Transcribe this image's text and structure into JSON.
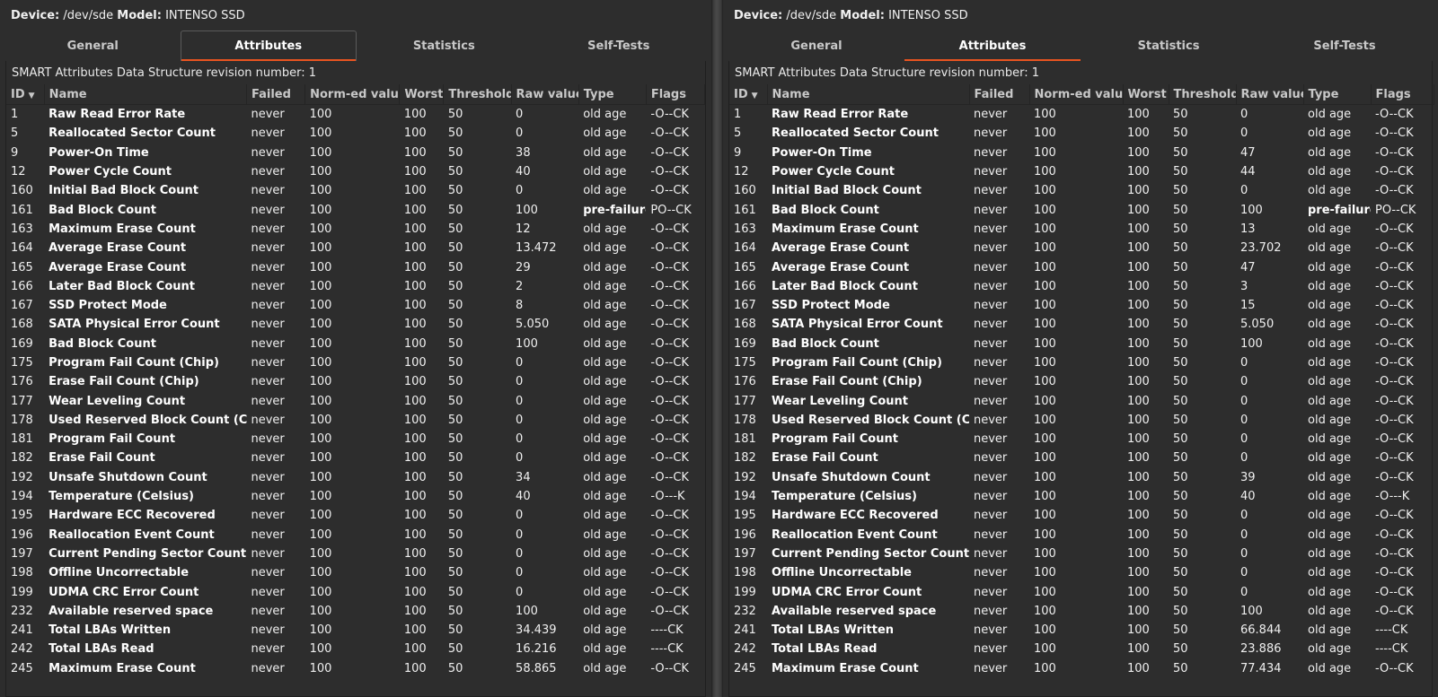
{
  "panels": [
    {
      "device_label": "Device:",
      "device_value": "/dev/sde",
      "model_label": "Model:",
      "model_value": "INTENSO SSD",
      "tabs": [
        "General",
        "Attributes",
        "Statistics",
        "Self-Tests"
      ],
      "active_tab": 1,
      "revision_text": "SMART Attributes Data Structure revision number: 1",
      "columns": [
        "ID",
        "Name",
        "Failed",
        "Norm-ed value",
        "Worst",
        "Threshold",
        "Raw value",
        "Type",
        "Flags"
      ],
      "sort_icon": "sort-descending-icon",
      "rows": [
        [
          "1",
          "Raw Read Error Rate",
          "never",
          "100",
          "100",
          "50",
          "0",
          "old age",
          "-O--CK"
        ],
        [
          "5",
          "Reallocated Sector Count",
          "never",
          "100",
          "100",
          "50",
          "0",
          "old age",
          "-O--CK"
        ],
        [
          "9",
          "Power-On Time",
          "never",
          "100",
          "100",
          "50",
          "38",
          "old age",
          "-O--CK"
        ],
        [
          "12",
          "Power Cycle Count",
          "never",
          "100",
          "100",
          "50",
          "40",
          "old age",
          "-O--CK"
        ],
        [
          "160",
          "Initial Bad Block Count",
          "never",
          "100",
          "100",
          "50",
          "0",
          "old age",
          "-O--CK"
        ],
        [
          "161",
          "Bad Block Count",
          "never",
          "100",
          "100",
          "50",
          "100",
          "pre-failure",
          "PO--CK"
        ],
        [
          "163",
          "Maximum Erase Count",
          "never",
          "100",
          "100",
          "50",
          "12",
          "old age",
          "-O--CK"
        ],
        [
          "164",
          "Average Erase Count",
          "never",
          "100",
          "100",
          "50",
          "13.472",
          "old age",
          "-O--CK"
        ],
        [
          "165",
          "Average Erase Count",
          "never",
          "100",
          "100",
          "50",
          "29",
          "old age",
          "-O--CK"
        ],
        [
          "166",
          "Later Bad Block Count",
          "never",
          "100",
          "100",
          "50",
          "2",
          "old age",
          "-O--CK"
        ],
        [
          "167",
          "SSD Protect Mode",
          "never",
          "100",
          "100",
          "50",
          "8",
          "old age",
          "-O--CK"
        ],
        [
          "168",
          "SATA Physical Error Count",
          "never",
          "100",
          "100",
          "50",
          "5.050",
          "old age",
          "-O--CK"
        ],
        [
          "169",
          "Bad Block Count",
          "never",
          "100",
          "100",
          "50",
          "100",
          "old age",
          "-O--CK"
        ],
        [
          "175",
          "Program Fail Count (Chip)",
          "never",
          "100",
          "100",
          "50",
          "0",
          "old age",
          "-O--CK"
        ],
        [
          "176",
          "Erase Fail Count (Chip)",
          "never",
          "100",
          "100",
          "50",
          "0",
          "old age",
          "-O--CK"
        ],
        [
          "177",
          "Wear Leveling Count",
          "never",
          "100",
          "100",
          "50",
          "0",
          "old age",
          "-O--CK"
        ],
        [
          "178",
          "Used Reserved Block Count (Chip)",
          "never",
          "100",
          "100",
          "50",
          "0",
          "old age",
          "-O--CK"
        ],
        [
          "181",
          "Program Fail Count",
          "never",
          "100",
          "100",
          "50",
          "0",
          "old age",
          "-O--CK"
        ],
        [
          "182",
          "Erase Fail Count",
          "never",
          "100",
          "100",
          "50",
          "0",
          "old age",
          "-O--CK"
        ],
        [
          "192",
          "Unsafe Shutdown Count",
          "never",
          "100",
          "100",
          "50",
          "34",
          "old age",
          "-O--CK"
        ],
        [
          "194",
          "Temperature (Celsius)",
          "never",
          "100",
          "100",
          "50",
          "40",
          "old age",
          "-O---K"
        ],
        [
          "195",
          "Hardware ECC Recovered",
          "never",
          "100",
          "100",
          "50",
          "0",
          "old age",
          "-O--CK"
        ],
        [
          "196",
          "Reallocation Event Count",
          "never",
          "100",
          "100",
          "50",
          "0",
          "old age",
          "-O--CK"
        ],
        [
          "197",
          "Current Pending Sector Count",
          "never",
          "100",
          "100",
          "50",
          "0",
          "old age",
          "-O--CK"
        ],
        [
          "198",
          "Offline Uncorrectable",
          "never",
          "100",
          "100",
          "50",
          "0",
          "old age",
          "-O--CK"
        ],
        [
          "199",
          "UDMA CRC Error Count",
          "never",
          "100",
          "100",
          "50",
          "0",
          "old age",
          "-O--CK"
        ],
        [
          "232",
          "Available reserved space",
          "never",
          "100",
          "100",
          "50",
          "100",
          "old age",
          "-O--CK"
        ],
        [
          "241",
          "Total LBAs Written",
          "never",
          "100",
          "100",
          "50",
          "34.439",
          "old age",
          "----CK"
        ],
        [
          "242",
          "Total LBAs Read",
          "never",
          "100",
          "100",
          "50",
          "16.216",
          "old age",
          "----CK"
        ],
        [
          "245",
          "Maximum Erase Count",
          "never",
          "100",
          "100",
          "50",
          "58.865",
          "old age",
          "-O--CK"
        ]
      ]
    },
    {
      "device_label": "Device:",
      "device_value": "/dev/sde",
      "model_label": "Model:",
      "model_value": "INTENSO SSD",
      "tabs": [
        "General",
        "Attributes",
        "Statistics",
        "Self-Tests"
      ],
      "active_tab": 1,
      "revision_text": "SMART Attributes Data Structure revision number: 1",
      "columns": [
        "ID",
        "Name",
        "Failed",
        "Norm-ed value",
        "Worst",
        "Threshold",
        "Raw value",
        "Type",
        "Flags"
      ],
      "sort_icon": "sort-descending-icon",
      "rows": [
        [
          "1",
          "Raw Read Error Rate",
          "never",
          "100",
          "100",
          "50",
          "0",
          "old age",
          "-O--CK"
        ],
        [
          "5",
          "Reallocated Sector Count",
          "never",
          "100",
          "100",
          "50",
          "0",
          "old age",
          "-O--CK"
        ],
        [
          "9",
          "Power-On Time",
          "never",
          "100",
          "100",
          "50",
          "47",
          "old age",
          "-O--CK"
        ],
        [
          "12",
          "Power Cycle Count",
          "never",
          "100",
          "100",
          "50",
          "44",
          "old age",
          "-O--CK"
        ],
        [
          "160",
          "Initial Bad Block Count",
          "never",
          "100",
          "100",
          "50",
          "0",
          "old age",
          "-O--CK"
        ],
        [
          "161",
          "Bad Block Count",
          "never",
          "100",
          "100",
          "50",
          "100",
          "pre-failure",
          "PO--CK"
        ],
        [
          "163",
          "Maximum Erase Count",
          "never",
          "100",
          "100",
          "50",
          "13",
          "old age",
          "-O--CK"
        ],
        [
          "164",
          "Average Erase Count",
          "never",
          "100",
          "100",
          "50",
          "23.702",
          "old age",
          "-O--CK"
        ],
        [
          "165",
          "Average Erase Count",
          "never",
          "100",
          "100",
          "50",
          "47",
          "old age",
          "-O--CK"
        ],
        [
          "166",
          "Later Bad Block Count",
          "never",
          "100",
          "100",
          "50",
          "3",
          "old age",
          "-O--CK"
        ],
        [
          "167",
          "SSD Protect Mode",
          "never",
          "100",
          "100",
          "50",
          "15",
          "old age",
          "-O--CK"
        ],
        [
          "168",
          "SATA Physical Error Count",
          "never",
          "100",
          "100",
          "50",
          "5.050",
          "old age",
          "-O--CK"
        ],
        [
          "169",
          "Bad Block Count",
          "never",
          "100",
          "100",
          "50",
          "100",
          "old age",
          "-O--CK"
        ],
        [
          "175",
          "Program Fail Count (Chip)",
          "never",
          "100",
          "100",
          "50",
          "0",
          "old age",
          "-O--CK"
        ],
        [
          "176",
          "Erase Fail Count (Chip)",
          "never",
          "100",
          "100",
          "50",
          "0",
          "old age",
          "-O--CK"
        ],
        [
          "177",
          "Wear Leveling Count",
          "never",
          "100",
          "100",
          "50",
          "0",
          "old age",
          "-O--CK"
        ],
        [
          "178",
          "Used Reserved Block Count (Chip)",
          "never",
          "100",
          "100",
          "50",
          "0",
          "old age",
          "-O--CK"
        ],
        [
          "181",
          "Program Fail Count",
          "never",
          "100",
          "100",
          "50",
          "0",
          "old age",
          "-O--CK"
        ],
        [
          "182",
          "Erase Fail Count",
          "never",
          "100",
          "100",
          "50",
          "0",
          "old age",
          "-O--CK"
        ],
        [
          "192",
          "Unsafe Shutdown Count",
          "never",
          "100",
          "100",
          "50",
          "39",
          "old age",
          "-O--CK"
        ],
        [
          "194",
          "Temperature (Celsius)",
          "never",
          "100",
          "100",
          "50",
          "40",
          "old age",
          "-O---K"
        ],
        [
          "195",
          "Hardware ECC Recovered",
          "never",
          "100",
          "100",
          "50",
          "0",
          "old age",
          "-O--CK"
        ],
        [
          "196",
          "Reallocation Event Count",
          "never",
          "100",
          "100",
          "50",
          "0",
          "old age",
          "-O--CK"
        ],
        [
          "197",
          "Current Pending Sector Count",
          "never",
          "100",
          "100",
          "50",
          "0",
          "old age",
          "-O--CK"
        ],
        [
          "198",
          "Offline Uncorrectable",
          "never",
          "100",
          "100",
          "50",
          "0",
          "old age",
          "-O--CK"
        ],
        [
          "199",
          "UDMA CRC Error Count",
          "never",
          "100",
          "100",
          "50",
          "0",
          "old age",
          "-O--CK"
        ],
        [
          "232",
          "Available reserved space",
          "never",
          "100",
          "100",
          "50",
          "100",
          "old age",
          "-O--CK"
        ],
        [
          "241",
          "Total LBAs Written",
          "never",
          "100",
          "100",
          "50",
          "66.844",
          "old age",
          "----CK"
        ],
        [
          "242",
          "Total LBAs Read",
          "never",
          "100",
          "100",
          "50",
          "23.886",
          "old age",
          "----CK"
        ],
        [
          "245",
          "Maximum Erase Count",
          "never",
          "100",
          "100",
          "50",
          "77.434",
          "old age",
          "-O--CK"
        ]
      ]
    }
  ]
}
